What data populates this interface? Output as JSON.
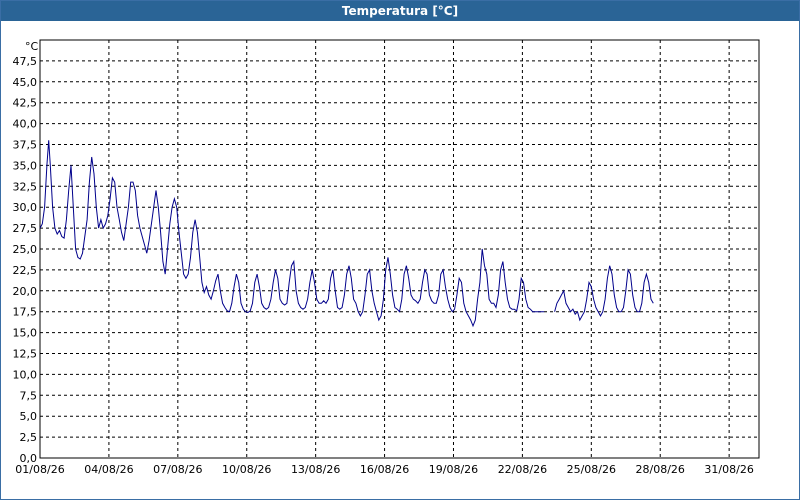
{
  "window": {
    "title": "Temperatura [°C]"
  },
  "chart_data": {
    "type": "line",
    "title": "Temperatura [°C]",
    "ylabel": "°C",
    "xlabel": "",
    "ylim": [
      0,
      50
    ],
    "xlim": [
      0,
      31.3
    ],
    "grid": true,
    "line_color": "#00008b",
    "y_ticks": [
      "0,0",
      "2,5",
      "5,0",
      "7,5",
      "10,0",
      "12,5",
      "15,0",
      "17,5",
      "20,0",
      "22,5",
      "25,0",
      "27,5",
      "30,0",
      "32,5",
      "35,0",
      "37,5",
      "40,0",
      "42,5",
      "45,0",
      "47,5"
    ],
    "x_ticks": [
      "01/08/26",
      "04/08/26",
      "07/08/26",
      "10/08/26",
      "13/08/26",
      "16/08/26",
      "19/08/26",
      "22/08/26",
      "25/08/26",
      "28/08/26",
      "31/08/26"
    ],
    "x_tick_days": [
      0,
      3,
      6,
      9,
      12,
      15,
      18,
      21,
      24,
      27,
      30
    ],
    "series": [
      {
        "segments": [
          [
            [
              0.0,
              27.5
            ],
            [
              0.1,
              28.0
            ],
            [
              0.2,
              30.0
            ],
            [
              0.3,
              35.0
            ],
            [
              0.38,
              38.0
            ],
            [
              0.45,
              35.0
            ],
            [
              0.55,
              30.0
            ],
            [
              0.65,
              27.5
            ],
            [
              0.75,
              26.8
            ],
            [
              0.85,
              27.2
            ],
            [
              0.95,
              26.5
            ],
            [
              1.05,
              26.3
            ],
            [
              1.15,
              28.5
            ],
            [
              1.25,
              32.0
            ],
            [
              1.35,
              35.0
            ],
            [
              1.45,
              30.0
            ],
            [
              1.55,
              25.0
            ],
            [
              1.65,
              24.0
            ],
            [
              1.75,
              23.8
            ],
            [
              1.85,
              24.5
            ],
            [
              1.95,
              26.5
            ],
            [
              2.05,
              28.5
            ],
            [
              2.15,
              33.0
            ],
            [
              2.25,
              36.0
            ],
            [
              2.35,
              34.0
            ],
            [
              2.45,
              30.0
            ],
            [
              2.55,
              27.5
            ],
            [
              2.65,
              28.5
            ],
            [
              2.75,
              27.5
            ],
            [
              2.85,
              28.0
            ],
            [
              2.95,
              29.0
            ],
            [
              3.05,
              31.0
            ],
            [
              3.15,
              33.5
            ],
            [
              3.25,
              33.0
            ],
            [
              3.35,
              30.0
            ],
            [
              3.45,
              28.5
            ],
            [
              3.55,
              27.0
            ],
            [
              3.65,
              26.0
            ],
            [
              3.75,
              28.0
            ],
            [
              3.85,
              30.0
            ],
            [
              3.95,
              33.0
            ],
            [
              4.05,
              33.0
            ],
            [
              4.15,
              32.0
            ],
            [
              4.25,
              29.0
            ],
            [
              4.35,
              27.5
            ],
            [
              4.45,
              26.5
            ],
            [
              4.55,
              25.5
            ],
            [
              4.65,
              24.5
            ],
            [
              4.75,
              26.0
            ],
            [
              4.85,
              28.0
            ],
            [
              4.95,
              30.0
            ],
            [
              5.05,
              32.0
            ],
            [
              5.15,
              30.0
            ],
            [
              5.25,
              27.0
            ],
            [
              5.35,
              23.5
            ],
            [
              5.45,
              22.0
            ],
            [
              5.55,
              25.0
            ],
            [
              5.65,
              28.0
            ],
            [
              5.75,
              30.0
            ],
            [
              5.85,
              31.0
            ],
            [
              5.95,
              30.0
            ],
            [
              6.05,
              27.0
            ],
            [
              6.15,
              24.5
            ],
            [
              6.25,
              22.0
            ],
            [
              6.35,
              21.5
            ],
            [
              6.45,
              22.0
            ],
            [
              6.55,
              24.0
            ],
            [
              6.65,
              27.0
            ],
            [
              6.75,
              28.5
            ],
            [
              6.85,
              27.0
            ],
            [
              6.95,
              24.0
            ],
            [
              7.05,
              21.0
            ],
            [
              7.15,
              19.8
            ],
            [
              7.25,
              20.5
            ],
            [
              7.35,
              19.5
            ],
            [
              7.45,
              19.0
            ],
            [
              7.55,
              20.0
            ],
            [
              7.65,
              21.2
            ],
            [
              7.75,
              22.0
            ],
            [
              7.85,
              20.0
            ],
            [
              7.95,
              18.5
            ],
            [
              8.05,
              18.0
            ],
            [
              8.15,
              17.6
            ],
            [
              8.25,
              17.5
            ],
            [
              8.35,
              18.5
            ],
            [
              8.45,
              20.5
            ],
            [
              8.55,
              22.0
            ],
            [
              8.65,
              21.0
            ],
            [
              8.75,
              18.5
            ],
            [
              8.85,
              17.8
            ],
            [
              8.95,
              17.5
            ],
            [
              9.05,
              17.4
            ],
            [
              9.15,
              17.6
            ],
            [
              9.25,
              18.5
            ],
            [
              9.35,
              21.0
            ],
            [
              9.45,
              22.0
            ],
            [
              9.55,
              20.5
            ],
            [
              9.65,
              18.5
            ],
            [
              9.75,
              18.0
            ],
            [
              9.85,
              17.8
            ],
            [
              9.95,
              18.0
            ],
            [
              10.05,
              19.0
            ],
            [
              10.15,
              21.0
            ],
            [
              10.25,
              22.5
            ],
            [
              10.35,
              21.5
            ],
            [
              10.45,
              19.0
            ],
            [
              10.55,
              18.5
            ],
            [
              10.65,
              18.3
            ],
            [
              10.75,
              18.5
            ],
            [
              10.85,
              21.0
            ],
            [
              10.95,
              23.0
            ],
            [
              11.05,
              23.5
            ],
            [
              11.15,
              20.0
            ],
            [
              11.25,
              18.5
            ],
            [
              11.35,
              18.0
            ],
            [
              11.45,
              17.8
            ],
            [
              11.55,
              18.0
            ],
            [
              11.65,
              19.0
            ],
            [
              11.75,
              21.0
            ],
            [
              11.85,
              22.5
            ],
            [
              11.95,
              21.0
            ],
            [
              12.05,
              19.0
            ],
            [
              12.15,
              18.5
            ],
            [
              12.25,
              18.5
            ],
            [
              12.35,
              18.8
            ],
            [
              12.45,
              18.5
            ],
            [
              12.55,
              19.0
            ],
            [
              12.65,
              21.5
            ],
            [
              12.75,
              22.5
            ],
            [
              12.85,
              20.0
            ],
            [
              12.95,
              18.0
            ],
            [
              13.05,
              17.8
            ],
            [
              13.15,
              18.0
            ],
            [
              13.25,
              19.5
            ],
            [
              13.35,
              22.0
            ],
            [
              13.45,
              23.0
            ],
            [
              13.55,
              21.5
            ],
            [
              13.65,
              19.0
            ],
            [
              13.75,
              18.5
            ],
            [
              13.85,
              17.5
            ],
            [
              13.95,
              17.0
            ],
            [
              14.05,
              17.5
            ],
            [
              14.15,
              19.5
            ],
            [
              14.25,
              22.0
            ],
            [
              14.35,
              22.5
            ],
            [
              14.45,
              20.0
            ],
            [
              14.55,
              18.5
            ],
            [
              14.65,
              17.5
            ],
            [
              14.75,
              16.5
            ],
            [
              14.85,
              17.0
            ],
            [
              14.95,
              19.0
            ],
            [
              15.05,
              22.5
            ],
            [
              15.15,
              24.0
            ],
            [
              15.25,
              22.0
            ],
            [
              15.35,
              19.5
            ],
            [
              15.45,
              18.0
            ],
            [
              15.55,
              17.8
            ],
            [
              15.65,
              17.5
            ],
            [
              15.75,
              19.0
            ],
            [
              15.85,
              22.0
            ],
            [
              15.95,
              23.0
            ],
            [
              16.05,
              21.5
            ],
            [
              16.15,
              19.5
            ],
            [
              16.25,
              19.0
            ],
            [
              16.35,
              18.8
            ],
            [
              16.45,
              18.5
            ],
            [
              16.55,
              19.0
            ],
            [
              16.65,
              21.0
            ],
            [
              16.75,
              22.5
            ],
            [
              16.85,
              22.0
            ],
            [
              16.95,
              19.5
            ],
            [
              17.05,
              18.8
            ],
            [
              17.15,
              18.5
            ],
            [
              17.25,
              18.5
            ],
            [
              17.35,
              19.5
            ],
            [
              17.45,
              22.0
            ],
            [
              17.55,
              22.5
            ],
            [
              17.65,
              20.5
            ],
            [
              17.75,
              19.0
            ],
            [
              17.85,
              18.0
            ],
            [
              17.95,
              17.5
            ],
            [
              18.05,
              17.8
            ],
            [
              18.15,
              19.5
            ],
            [
              18.25,
              21.5
            ],
            [
              18.35,
              21.0
            ],
            [
              18.45,
              18.5
            ],
            [
              18.55,
              17.5
            ],
            [
              18.65,
              17.0
            ],
            [
              18.75,
              16.5
            ],
            [
              18.85,
              15.8
            ],
            [
              18.95,
              16.5
            ],
            [
              19.05,
              19.0
            ],
            [
              19.15,
              21.0
            ],
            [
              19.25,
              25.0
            ],
            [
              19.35,
              23.0
            ],
            [
              19.45,
              22.0
            ],
            [
              19.55,
              19.0
            ],
            [
              19.65,
              18.5
            ],
            [
              19.75,
              18.5
            ],
            [
              19.85,
              18.0
            ],
            [
              19.95,
              19.5
            ],
            [
              20.05,
              22.5
            ],
            [
              20.15,
              23.5
            ],
            [
              20.25,
              21.0
            ],
            [
              20.35,
              19.0
            ],
            [
              20.45,
              18.0
            ],
            [
              20.55,
              17.8
            ],
            [
              20.65,
              17.8
            ],
            [
              20.75,
              17.6
            ],
            [
              20.85,
              19.0
            ],
            [
              20.95,
              21.5
            ],
            [
              21.05,
              21.0
            ],
            [
              21.15,
              19.0
            ],
            [
              21.25,
              18.0
            ],
            [
              21.35,
              17.8
            ],
            [
              21.45,
              17.5
            ],
            [
              21.55,
              17.5
            ],
            [
              21.65,
              17.5
            ],
            [
              21.75,
              17.5
            ],
            [
              21.85,
              17.5
            ],
            [
              21.95,
              17.5
            ]
          ],
          [
            [
              22.4,
              17.5
            ],
            [
              22.5,
              18.5
            ],
            [
              22.6,
              19.0
            ],
            [
              22.7,
              19.5
            ],
            [
              22.8,
              20.0
            ],
            [
              22.9,
              18.5
            ],
            [
              23.0,
              18.0
            ],
            [
              23.1,
              17.5
            ],
            [
              23.2,
              17.8
            ],
            [
              23.3,
              17.2
            ],
            [
              23.4,
              17.5
            ],
            [
              23.5,
              16.5
            ],
            [
              23.6,
              17.0
            ],
            [
              23.7,
              17.5
            ],
            [
              23.8,
              19.0
            ],
            [
              23.9,
              21.0
            ],
            [
              24.0,
              20.5
            ],
            [
              24.1,
              19.0
            ],
            [
              24.2,
              18.0
            ],
            [
              24.3,
              17.5
            ],
            [
              24.4,
              17.0
            ],
            [
              24.5,
              17.5
            ],
            [
              24.6,
              19.0
            ],
            [
              24.7,
              21.5
            ],
            [
              24.8,
              23.0
            ],
            [
              24.9,
              22.0
            ],
            [
              25.0,
              19.5
            ],
            [
              25.1,
              18.0
            ],
            [
              25.2,
              17.5
            ],
            [
              25.3,
              17.5
            ],
            [
              25.4,
              18.0
            ],
            [
              25.5,
              20.0
            ],
            [
              25.6,
              22.5
            ],
            [
              25.7,
              22.0
            ],
            [
              25.8,
              19.5
            ],
            [
              25.9,
              18.0
            ],
            [
              26.0,
              17.5
            ],
            [
              26.1,
              17.5
            ],
            [
              26.2,
              18.5
            ],
            [
              26.3,
              21.0
            ],
            [
              26.4,
              22.0
            ],
            [
              26.5,
              21.0
            ],
            [
              26.6,
              19.0
            ],
            [
              26.7,
              18.5
            ]
          ]
        ]
      }
    ]
  }
}
